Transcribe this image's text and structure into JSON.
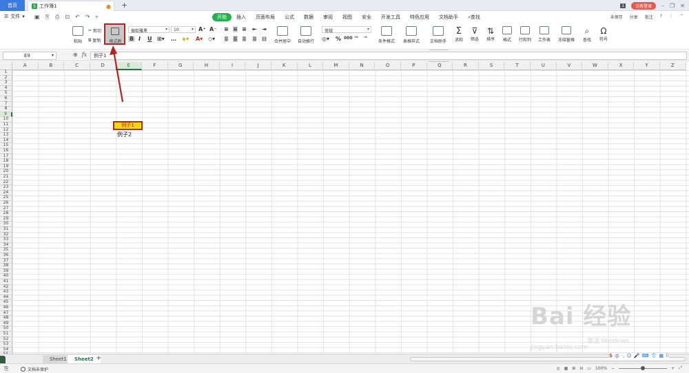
{
  "titlebar": {
    "home": "首页",
    "doc_tab": "工作簿1",
    "doc_icon": "S",
    "new_tab": "+",
    "badge": "1",
    "login": "访客登录"
  },
  "menubar": {
    "file": "文件",
    "tabs": [
      "开始",
      "插入",
      "页面布局",
      "公式",
      "数据",
      "审阅",
      "视图",
      "安全",
      "开发工具",
      "特色应用",
      "文档助手"
    ],
    "search": "查找",
    "right": [
      "未保存",
      "分享",
      "批注"
    ]
  },
  "ribbon": {
    "paste": "粘贴",
    "cut": "剪切",
    "copy": "复制",
    "format_painter": "格式刷",
    "font": "微软雅黑",
    "size": "10",
    "bold": "B",
    "italic": "I",
    "underline": "U",
    "merge": "合并居中",
    "wrap": "自动换行",
    "number_format": "常规",
    "cond_format": "条件格式",
    "table_style": "表格样式",
    "doc_helper": "文档助手",
    "sum": "求和",
    "filter": "筛选",
    "sort": "排序",
    "format": "格式",
    "rowcol": "行和列",
    "sheet": "工作表",
    "freeze": "冻结窗格",
    "find": "查找",
    "symbol": "符号",
    "percent": "%",
    "thousands": "000"
  },
  "formulabar": {
    "namebox": "E9",
    "fx": "fx",
    "value": "例子1"
  },
  "grid": {
    "columns": [
      "A",
      "B",
      "C",
      "D",
      "E",
      "F",
      "G",
      "H",
      "I",
      "J",
      "K",
      "L",
      "M",
      "N",
      "O",
      "P",
      "Q",
      "R",
      "S",
      "T",
      "U",
      "V",
      "W",
      "X",
      "Y",
      "Z"
    ],
    "selected_col": "E",
    "selected_row": 9,
    "row_count": 55
  },
  "cells": {
    "e9": "例子1",
    "e10": "例子2"
  },
  "sheets": {
    "tabs": [
      "Sheet1",
      "Sheet2"
    ],
    "active": "Sheet2",
    "add": "+"
  },
  "statusbar": {
    "protect": "文档未保护",
    "zoom": "100%"
  },
  "ime": [
    "S",
    "中",
    "·,",
    "☺",
    "🎤",
    "⌨",
    "👕",
    "▦",
    "⠿"
  ],
  "watermark": {
    "brand": "Bai 经验",
    "line2": "激活 Windows",
    "line3": "jingyan.baidu.com"
  },
  "colors": {
    "accent": "#22b14c",
    "highlight_border": "#b3231f",
    "cell_fill": "#f7d21a",
    "cell_text": "#d21f1f"
  }
}
